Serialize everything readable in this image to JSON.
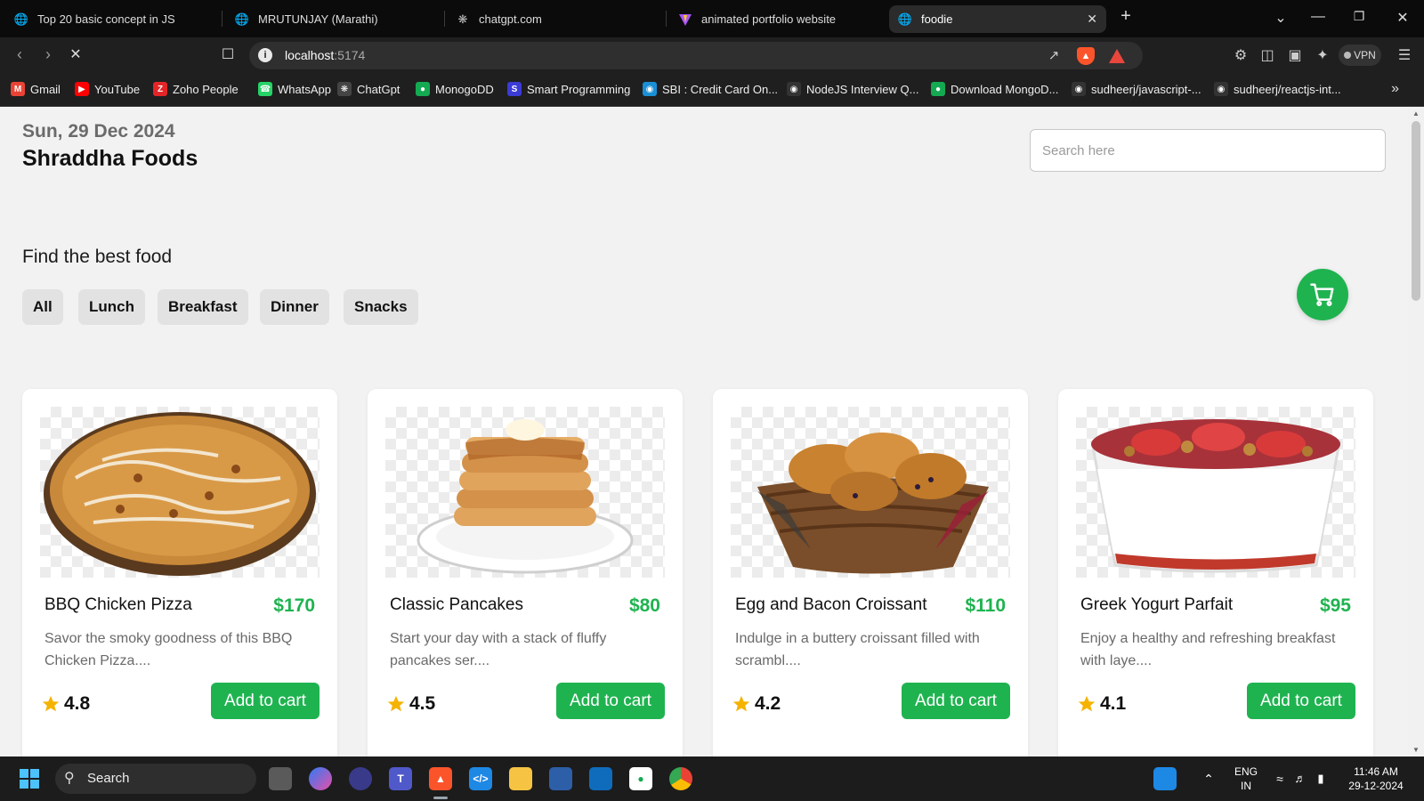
{
  "browser": {
    "tabs": [
      {
        "title": "Top 20 basic concept in JS",
        "icon": "globe-icon"
      },
      {
        "title": "MRUTUNJAY (Marathi)",
        "icon": "globe-icon"
      },
      {
        "title": "chatgpt.com",
        "icon": "chatgpt-icon"
      },
      {
        "title": "animated portfolio website",
        "icon": "vite-icon"
      },
      {
        "title": "foodie",
        "icon": "globe-icon",
        "active": true
      }
    ],
    "url_host": "localhost",
    "url_port": ":5174",
    "vpn_label": "VPN",
    "bookmarks": [
      {
        "label": "Gmail",
        "icon": "gmail-icon",
        "color": "#ea4335"
      },
      {
        "label": "YouTube",
        "icon": "youtube-icon",
        "color": "#ff0000"
      },
      {
        "label": "Zoho People",
        "icon": "zoho-icon",
        "color": "#e42527"
      },
      {
        "label": "WhatsApp",
        "icon": "whatsapp-icon",
        "color": "#25d366"
      },
      {
        "label": "ChatGpt",
        "icon": "chatgpt-icon",
        "color": "#444444"
      },
      {
        "label": "MonogoDD",
        "icon": "mongodb-icon",
        "color": "#13aa52"
      },
      {
        "label": "Smart Programming",
        "icon": "smart-programming-icon",
        "color": "#3b3bd6"
      },
      {
        "label": "SBI : Credit Card On...",
        "icon": "sbi-icon",
        "color": "#1a8fd6"
      },
      {
        "label": "NodeJS Interview Q...",
        "icon": "github-icon",
        "color": "#333333"
      },
      {
        "label": "Download MongoD...",
        "icon": "mongodb-icon",
        "color": "#13aa52"
      },
      {
        "label": "sudheerj/javascript-...",
        "icon": "github-icon",
        "color": "#333333"
      },
      {
        "label": "sudheerj/reactjs-int...",
        "icon": "github-icon",
        "color": "#333333"
      }
    ]
  },
  "header": {
    "date": "Sun, 29 Dec 2024",
    "brand": "Shraddha Foods",
    "search_placeholder": "Search here"
  },
  "filters": {
    "title": "Find the best food",
    "categories": [
      "All",
      "Lunch",
      "Breakfast",
      "Dinner",
      "Snacks"
    ]
  },
  "cart": {
    "icon": "cart-icon",
    "color": "#1fb350"
  },
  "products": [
    {
      "name": "BBQ Chicken Pizza",
      "price": "$170",
      "description": "Savor the smoky goodness of this BBQ Chicken Pizza....",
      "rating": "4.8",
      "button": "Add to cart",
      "image": "pizza"
    },
    {
      "name": "Classic Pancakes",
      "price": "$80",
      "description": "Start your day with a stack of fluffy pancakes ser....",
      "rating": "4.5",
      "button": "Add to cart",
      "image": "pancakes"
    },
    {
      "name": "Egg and Bacon Croissant",
      "price": "$110",
      "description": "Indulge in a buttery croissant filled with scrambl....",
      "rating": "4.2",
      "button": "Add to cart",
      "image": "croissant"
    },
    {
      "name": "Greek Yogurt Parfait",
      "price": "$95",
      "description": "Enjoy a healthy and refreshing breakfast with laye....",
      "rating": "4.1",
      "button": "Add to cart",
      "image": "parfait"
    }
  ],
  "taskbar": {
    "search_label": "Search",
    "lang_top": "ENG",
    "lang_bottom": "IN",
    "time": "11:46 AM",
    "date": "29-12-2024"
  },
  "colors": {
    "accent": "#1fb350",
    "star": "#f5b301"
  }
}
